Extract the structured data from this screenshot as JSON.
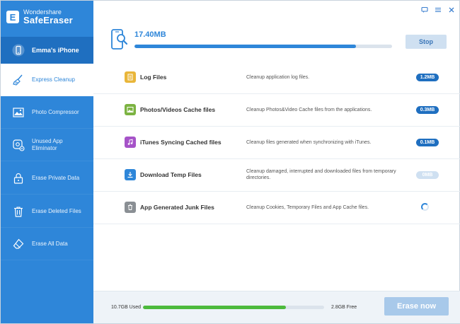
{
  "app": {
    "brand_line1": "Wondershare",
    "brand_line2": "SafeEraser"
  },
  "sidebar": {
    "device": "Emma's iPhone",
    "items": [
      {
        "label": "Express Cleanup",
        "icon": "broom-icon",
        "active": true
      },
      {
        "label": "Photo Compressor",
        "icon": "image-icon",
        "active": false
      },
      {
        "label": "Unused App Eliminator",
        "icon": "app-remove-icon",
        "active": false
      },
      {
        "label": "Erase Private Data",
        "icon": "lock-icon",
        "active": false
      },
      {
        "label": "Erase Deleted Files",
        "icon": "trash-icon",
        "active": false
      },
      {
        "label": "Erase All Data",
        "icon": "eraser-icon",
        "active": false
      }
    ]
  },
  "window_controls": [
    "feedback-icon",
    "menu-icon",
    "close-icon"
  ],
  "scan": {
    "size": "17.40MB",
    "progress_fraction": 0.86,
    "stop_label": "Stop"
  },
  "rows": [
    {
      "name": "Log Files",
      "description": "Cleanup application log files.",
      "size": "1.2MB",
      "icon": "log-files-icon",
      "color": "#e9b63a",
      "status": "done"
    },
    {
      "name": "Photos/Videos Cache files",
      "description": "Cleanup Photos&Video Cache files from the applications.",
      "size": "0.3MB",
      "icon": "photo-cache-icon",
      "color": "#7cb342",
      "status": "done"
    },
    {
      "name": "iTunes Syncing Cached files",
      "description": "Cleanup files generated when synchronizing with iTunes.",
      "size": "0.1MB",
      "icon": "music-icon",
      "color": "#a653c8",
      "status": "done"
    },
    {
      "name": "Download Temp Files",
      "description": "Cleanup damaged, interrupted and downloaded files from temporary directories.",
      "size": "0MB",
      "icon": "download-icon",
      "color": "#2e86d9",
      "status": "empty"
    },
    {
      "name": "App Generated Junk Files",
      "description": "Cleanup Cookies, Temporary Files and App Cache files.",
      "size": "",
      "icon": "junk-files-icon",
      "color": "#8a8f94",
      "status": "scanning"
    }
  ],
  "footer": {
    "used": "10.7GB Used",
    "free": "2.8GB Free",
    "used_fraction": 0.79,
    "erase_label": "Erase now"
  },
  "colors": {
    "sidebar": "#2e86d9",
    "device_bar": "#1f6fc0",
    "progress": "#2e86d9",
    "storage": "#4cba3c",
    "erase_button": "#a8c9ea"
  }
}
